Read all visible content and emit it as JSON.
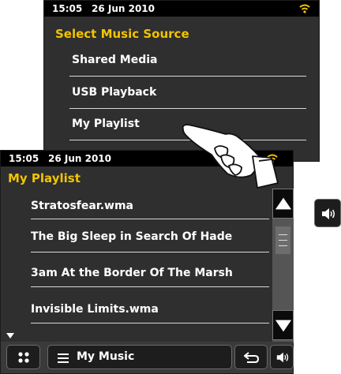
{
  "back_screen": {
    "status": {
      "time": "15:05",
      "date": "26 Jun 2010"
    },
    "title": "Select Music Source",
    "items": [
      {
        "label": "Shared Media"
      },
      {
        "label": "USB Playback"
      },
      {
        "label": "My Playlist"
      }
    ]
  },
  "front_screen": {
    "status": {
      "time": "15:05",
      "date": "26 Jun 2010"
    },
    "title": "My Playlist",
    "items": [
      {
        "label": "Stratosfear.wma"
      },
      {
        "label": "The Big Sleep in Search Of Hade"
      },
      {
        "label": "3am At the Border Of The Marsh"
      },
      {
        "label": "Invisible Limits.wma"
      }
    ],
    "bottom_bar": {
      "mode_label": "My Music"
    }
  },
  "colors": {
    "accent": "#f2c400",
    "background": "#2f2f2f",
    "status_bar": "#000000"
  }
}
